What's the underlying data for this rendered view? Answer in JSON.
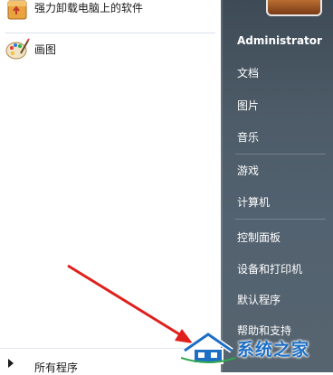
{
  "programs": [
    {
      "label": "强力卸载电脑上的软件",
      "icon": "uninstaller-box-icon"
    },
    {
      "label": "画图",
      "icon": "paint-palette-icon"
    }
  ],
  "all_programs": {
    "label": "所有程序"
  },
  "right_pane": {
    "user": "Administrator",
    "items": [
      "文档",
      "图片",
      "音乐",
      "游戏",
      "计算机",
      "控制面板",
      "设备和打印机",
      "默认程序",
      "帮助和支持"
    ]
  },
  "watermark": {
    "text": "系统之家"
  },
  "colors": {
    "right_pane": "#4c5b67",
    "annotation_arrow": "#e0201b",
    "watermark": "#1d6fc4"
  }
}
